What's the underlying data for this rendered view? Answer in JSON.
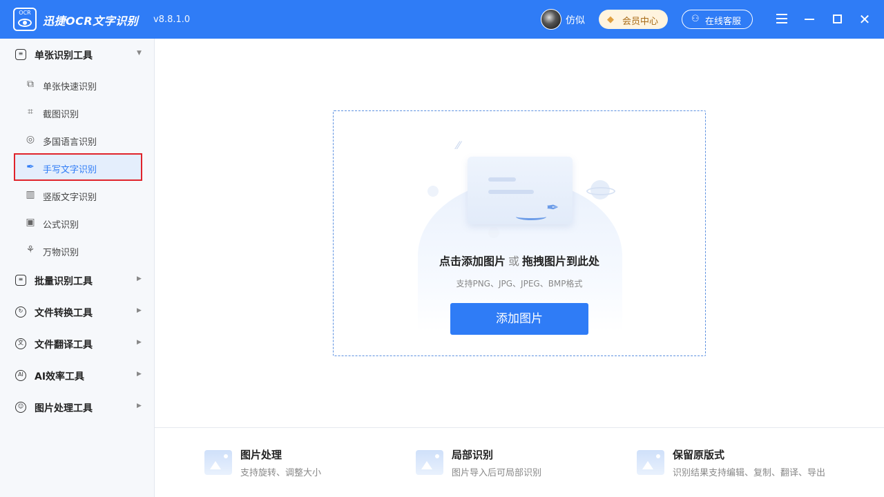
{
  "titlebar": {
    "logo_text": "OCR",
    "app_name": "迅捷OCR文字识别",
    "version": "v8.8.1.0",
    "username": "仿似",
    "vip_label": "会员中心",
    "service_label": "在线客服"
  },
  "sidebar": {
    "groups": [
      {
        "label": "单张识别工具",
        "icon": "single-doc-icon",
        "expanded": true
      },
      {
        "label": "批量识别工具",
        "icon": "batch-doc-icon",
        "expanded": false
      },
      {
        "label": "文件转换工具",
        "icon": "convert-icon",
        "expanded": false
      },
      {
        "label": "文件翻译工具",
        "icon": "translate-icon",
        "expanded": false
      },
      {
        "label": "AI效率工具",
        "icon": "ai-icon",
        "expanded": false
      },
      {
        "label": "图片处理工具",
        "icon": "image-process-icon",
        "expanded": false
      }
    ],
    "items": [
      {
        "label": "单张快速识别",
        "icon": "quick-scan-icon"
      },
      {
        "label": "截图识别",
        "icon": "crop-icon"
      },
      {
        "label": "多国语言识别",
        "icon": "globe-icon"
      },
      {
        "label": "手写文字识别",
        "icon": "pen-icon",
        "active": true
      },
      {
        "label": "竖版文字识别",
        "icon": "vertical-text-icon"
      },
      {
        "label": "公式识别",
        "icon": "formula-icon"
      },
      {
        "label": "万物识别",
        "icon": "objects-icon"
      }
    ]
  },
  "dropzone": {
    "title_part1": "点击添加图片",
    "title_or": "或",
    "title_part2": "拖拽图片到此处",
    "formats": "支持PNG、JPG、JPEG、BMP格式",
    "button": "添加图片"
  },
  "features": [
    {
      "name": "图片处理",
      "desc": "支持旋转、调整大小"
    },
    {
      "name": "局部识别",
      "desc": "图片导入后可局部识别"
    },
    {
      "name": "保留原版式",
      "desc": "识别结果支持编辑、复制、翻译、导出"
    }
  ],
  "colors": {
    "accent": "#2f7cf6",
    "highlight_border": "#e0232a"
  }
}
